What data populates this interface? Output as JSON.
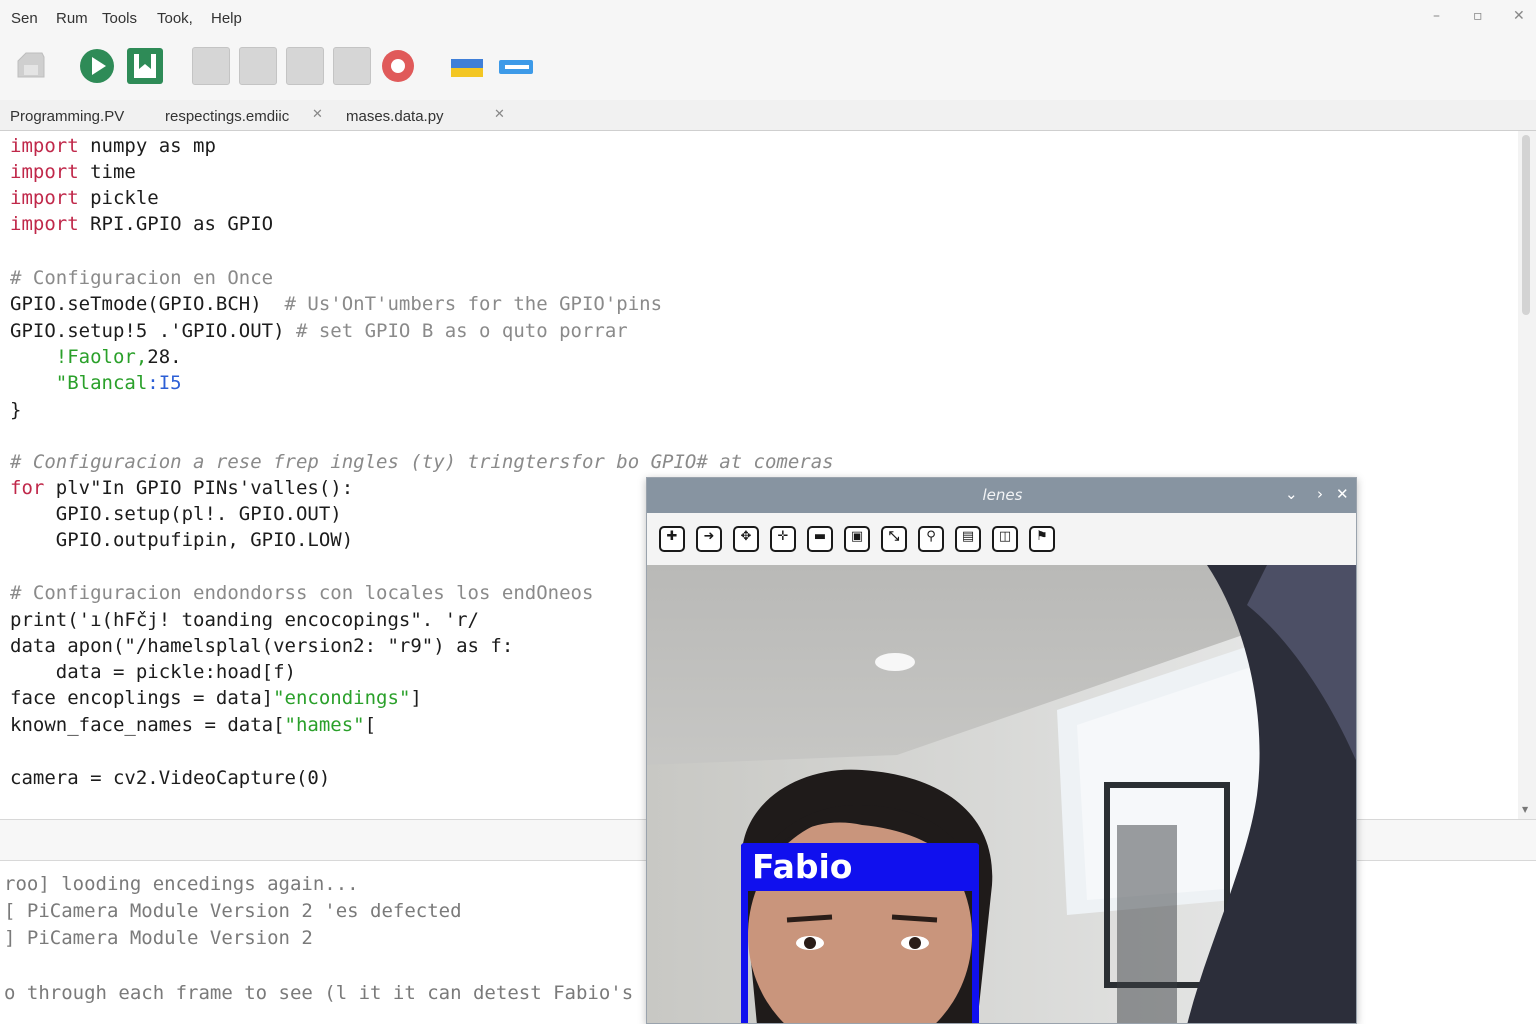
{
  "menu": {
    "items": [
      "Sen",
      "Rum",
      "Tools",
      "Took,",
      "Help"
    ]
  },
  "window_controls": {
    "minimize": "–",
    "restore": "▫",
    "close": "✕"
  },
  "tabs": [
    {
      "label": "Programming.PV",
      "close": ""
    },
    {
      "label": "respectings.emdiic",
      "close": "✕"
    },
    {
      "label": "mases.data.py",
      "close": "✕"
    }
  ],
  "editor": {
    "lines": [
      [
        "import",
        " numpy as mp"
      ],
      [
        "import",
        " time"
      ],
      [
        "import",
        " pickle"
      ],
      [
        "import",
        " RPI.GPIO as GPIO"
      ],
      "# Configuracion en Once",
      [
        "GPIO.seTmode(GPIO.BCH)  ",
        "# Us'OnT'umbers for the GPIO'pins"
      ],
      [
        "GPIO.setup!5 .'GPIO.OUT) ",
        "# set GPIO B as o quto porrar"
      ],
      [
        "    !Faolor,",
        "28."
      ],
      [
        "    \"Blancal",
        ":I5"
      ],
      "}",
      "# Configuracion a rese frep ingles (ty) tringtersfor bo GPIO# at comeras",
      [
        "for",
        " plv\"In GPIO PINs'valles():"
      ],
      "    GPIO.setup(pl!. GPIO.OUT)",
      "    GPIO.outpufipin, GPIO.LOW)",
      "# Configuracion endondorss con locales los endOneos",
      "print('ı(hFčj! toanding encocopings\". 'r/",
      "data apon(\"/hamelsplal(version2: \"r9\") as f:",
      "    data = pickle:hoad[f)",
      [
        "face encoplings = data]",
        "\"encondings\"",
        "]"
      ],
      [
        "known_face_names = data[",
        "\"hames\"",
        "["
      ],
      "camera = cv2.VideoCapture(0)"
    ]
  },
  "shell": {
    "lines": [
      "roo] looding encedings again...",
      "[ PiCamera Module Version 2 'es defected",
      "] PiCamera Module Version 2",
      "o through each frame to see (l it it can detest Fabio's"
    ]
  },
  "camera_window": {
    "title": "lenes",
    "controls": {
      "collapse": "⌄",
      "more": "›",
      "close": "✕"
    },
    "tools": [
      "pan-left",
      "arrow-right",
      "move-up",
      "move-split",
      "window",
      "fit",
      "zoom-tool",
      "zoom-search",
      "copy",
      "save",
      "export"
    ],
    "detection_label": "Fabio",
    "box_color": "#1010ee"
  },
  "colors": {
    "keyword": "#c0284a",
    "comment": "#8a8a8a",
    "string": "#2aa02a",
    "number": "#2c5fd6",
    "run_button": "#2e8b57",
    "stop_button": "#e05a5a"
  }
}
